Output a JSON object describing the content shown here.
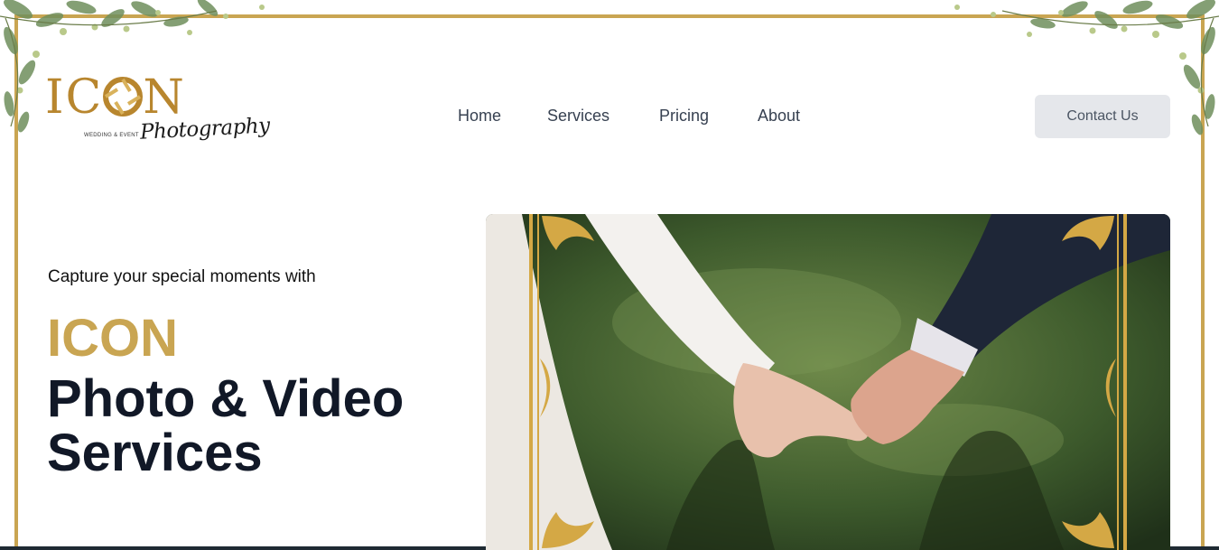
{
  "logo": {
    "wordmark_left": "IC",
    "wordmark_right": "N",
    "subtitle": "WEDDING & EVENT",
    "script": "Photography"
  },
  "nav": {
    "items": [
      {
        "label": "Home"
      },
      {
        "label": "Services"
      },
      {
        "label": "Pricing"
      },
      {
        "label": "About"
      }
    ],
    "contact_label": "Contact Us"
  },
  "hero": {
    "intro": "Capture your special moments with",
    "brand": "ICON",
    "title_line1": "Photo & Video",
    "title_line2": "Services"
  },
  "colors": {
    "gold": "#c9a552",
    "dark_text": "#111827",
    "nav_text": "#374151",
    "button_bg": "#e5e7eb"
  },
  "icons": {
    "decor": [
      "leaf-garland-icon",
      "aperture-icon",
      "ornament-frame-icon"
    ]
  }
}
